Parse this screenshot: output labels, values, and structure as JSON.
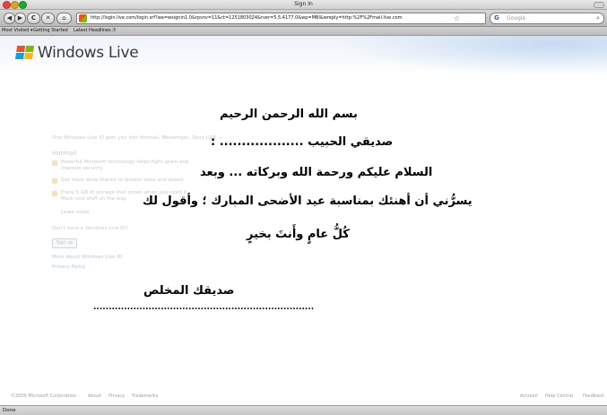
{
  "window": {
    "title": "Sign In"
  },
  "toolbar": {
    "back": "◀",
    "forward": "▶",
    "reload": "C",
    "stop": "✕",
    "home": "⌂",
    "url": "http://login.live.com/login.srf?wa=wsignin1.0&rpsnv=11&ct=1251803024&rver=5.5.4177.0&wp=MBI&wreply=http:%2F%2Fmail.live.com",
    "search_placeholder": "Google"
  },
  "bookmarks": [
    "Most Visited ▾",
    "Getting Started",
    "Latest Headlines ℛ"
  ],
  "page": {
    "brand": "Windows Live",
    "intro": "One Windows Live ID gets you into Hotmail, Messenger, Xbox LIVE —",
    "section_title": "Hotmail",
    "features": [
      "Powerful Microsoft technology helps fight spam and improve security.",
      "Get more done thanks to greater ease and speed.",
      "Enjoy 5 GB of storage that grows when you need it. More cool stuff on the way."
    ],
    "learn_more": "Learn more",
    "no_id": "Don't have a Windows Live ID?",
    "signup": "Sign up",
    "more_about": "More about Windows Live ID",
    "privacy": "Privacy Policy"
  },
  "letter": {
    "line1": "بسم الله الرحمن الرحيم",
    "line2": "صديقي الحبيب ................... :",
    "line3": "السلام عليكم ورحمة الله وبركاته ... وبعد",
    "line4": "يسرُّني أن أهنئك بمناسبة عيد الأضحى المبارك ؛ وأقول لك",
    "line5": "كُلُّ عامٍ وأَنتَ بخيرٍ",
    "line6": "صديقك المخلص",
    "dots": "........................................................................"
  },
  "footer": {
    "copyright": "©2009 Microsoft Corporation",
    "about": "About",
    "privacy": "Privacy",
    "trademarks": "Trademarks",
    "account": "Account",
    "help": "Help Central",
    "feedback": "Feedback"
  },
  "status": "Done"
}
